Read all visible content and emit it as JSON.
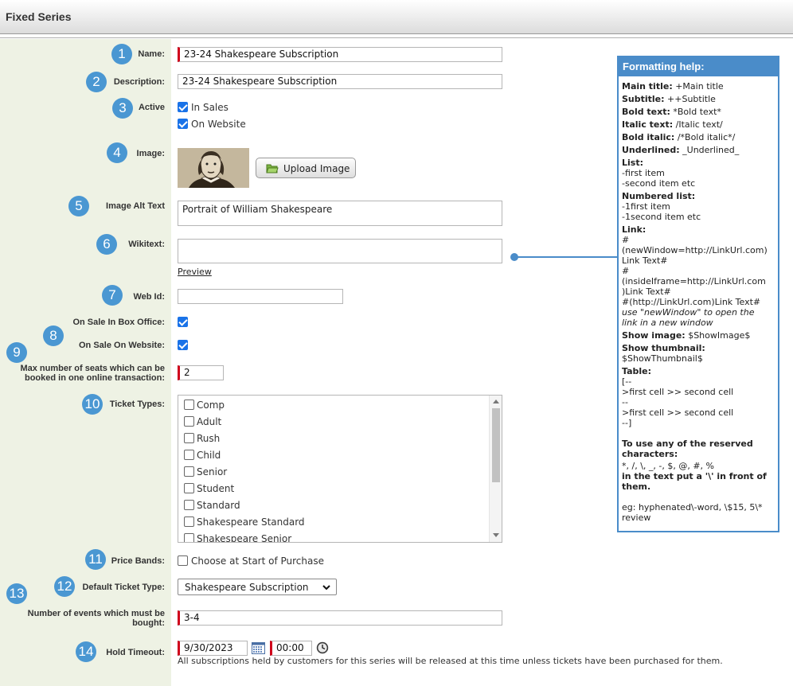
{
  "header": {
    "title": "Fixed Series"
  },
  "form": {
    "name": {
      "badge": "1",
      "label": "Name:",
      "value": "23-24 Shakespeare Subscription"
    },
    "description": {
      "badge": "2",
      "label": "Description:",
      "value": "23-24 Shakespeare Subscription"
    },
    "active": {
      "badge": "3",
      "label": "Active",
      "options": [
        {
          "label": "In Sales",
          "checked": true
        },
        {
          "label": "On Website",
          "checked": true
        }
      ]
    },
    "image": {
      "badge": "4",
      "label": "Image:",
      "upload_label": "Upload Image",
      "alt": "Portrait of William Shakespeare"
    },
    "image_alt": {
      "badge": "5",
      "label": "Image Alt Text",
      "value": "Portrait of William Shakespeare"
    },
    "wikitext": {
      "badge": "6",
      "label": "Wikitext:",
      "value": "",
      "preview_label": "Preview"
    },
    "web_id": {
      "badge": "7",
      "label": "Web Id:",
      "value": ""
    },
    "on_sale_box_office": {
      "label": "On Sale In Box Office:",
      "checked": true
    },
    "on_sale_website": {
      "badge": "8",
      "label": "On Sale On Website:",
      "checked": true
    },
    "max_seats": {
      "badge": "9",
      "label": "Max number of seats which can be booked in one online transaction:",
      "value": "2"
    },
    "ticket_types": {
      "badge": "10",
      "label": "Ticket Types:",
      "items": [
        "Comp",
        "Adult",
        "Rush",
        "Child",
        "Senior",
        "Student",
        "Standard",
        "Shakespeare Standard",
        "Shakespeare Senior"
      ]
    },
    "price_bands": {
      "badge": "11",
      "label": "Price Bands:",
      "option": "Choose at Start of Purchase",
      "checked": false
    },
    "default_ticket_type": {
      "badge": "12",
      "label": "Default Ticket Type:",
      "value": "Shakespeare Subscription"
    },
    "events_required": {
      "badge": "13",
      "label": "Number of events which must be bought:",
      "value": "3-4"
    },
    "hold_timeout": {
      "badge": "14",
      "label": "Hold Timeout:",
      "date": "9/30/2023",
      "time": "00:00",
      "note": "All subscriptions held by customers for this series will be released at this time unless tickets have been purchased for them."
    }
  },
  "help": {
    "title": "Formatting help:",
    "main_title": {
      "label": "Main title:",
      "text": "+Main title"
    },
    "subtitle": {
      "label": "Subtitle:",
      "text": "++Subtitle"
    },
    "bold": {
      "label": "Bold text:",
      "text": "*Bold text*"
    },
    "italic": {
      "label": "Italic text:",
      "text": "/Italic text/"
    },
    "bold_italic": {
      "label": "Bold italic:",
      "text": "/*Bold italic*/"
    },
    "underlined": {
      "label": "Underlined:",
      "text": "_Underlined_"
    },
    "list": {
      "label": "List:",
      "lines": [
        "-first item",
        "-second item etc"
      ]
    },
    "numbered_list": {
      "label": "Numbered list:",
      "lines": [
        "-1first item",
        "-1second item etc"
      ]
    },
    "link": {
      "label": "Link:",
      "lines": [
        "#",
        "(newWindow=http://LinkUrl.com)",
        "Link Text#",
        "#",
        "(insideIframe=http://LinkUrl.com",
        ")Link Text#",
        "#(http://LinkUrl.com)Link Text#"
      ],
      "note_lines": [
        "use \"newWindow\" to open the",
        "link in a new window"
      ]
    },
    "show_image": {
      "label": "Show image:",
      "text": "$ShowImage$"
    },
    "show_thumbnail": {
      "label": "Show thumbnail:",
      "text": "$ShowThumbnail$"
    },
    "table": {
      "label": "Table:",
      "lines": [
        "[--",
        ">first cell >> second cell",
        "--",
        ">first cell >> second cell",
        "--]"
      ]
    },
    "reserved_title": [
      "To use any of the reserved",
      "characters:"
    ],
    "reserved_chars": "*, /, \\, _, -, $, @, #, %",
    "reserved_tail": [
      "in the text put a '\\' in front of",
      "them."
    ],
    "example_lines": [
      "eg: hyphenated\\-word, \\$15, 5\\*",
      "review"
    ]
  },
  "colors": {
    "badge": "#4a97d2",
    "help_border": "#4a8cc9",
    "required": "#d0021b",
    "label_column": "#eef2e4"
  }
}
